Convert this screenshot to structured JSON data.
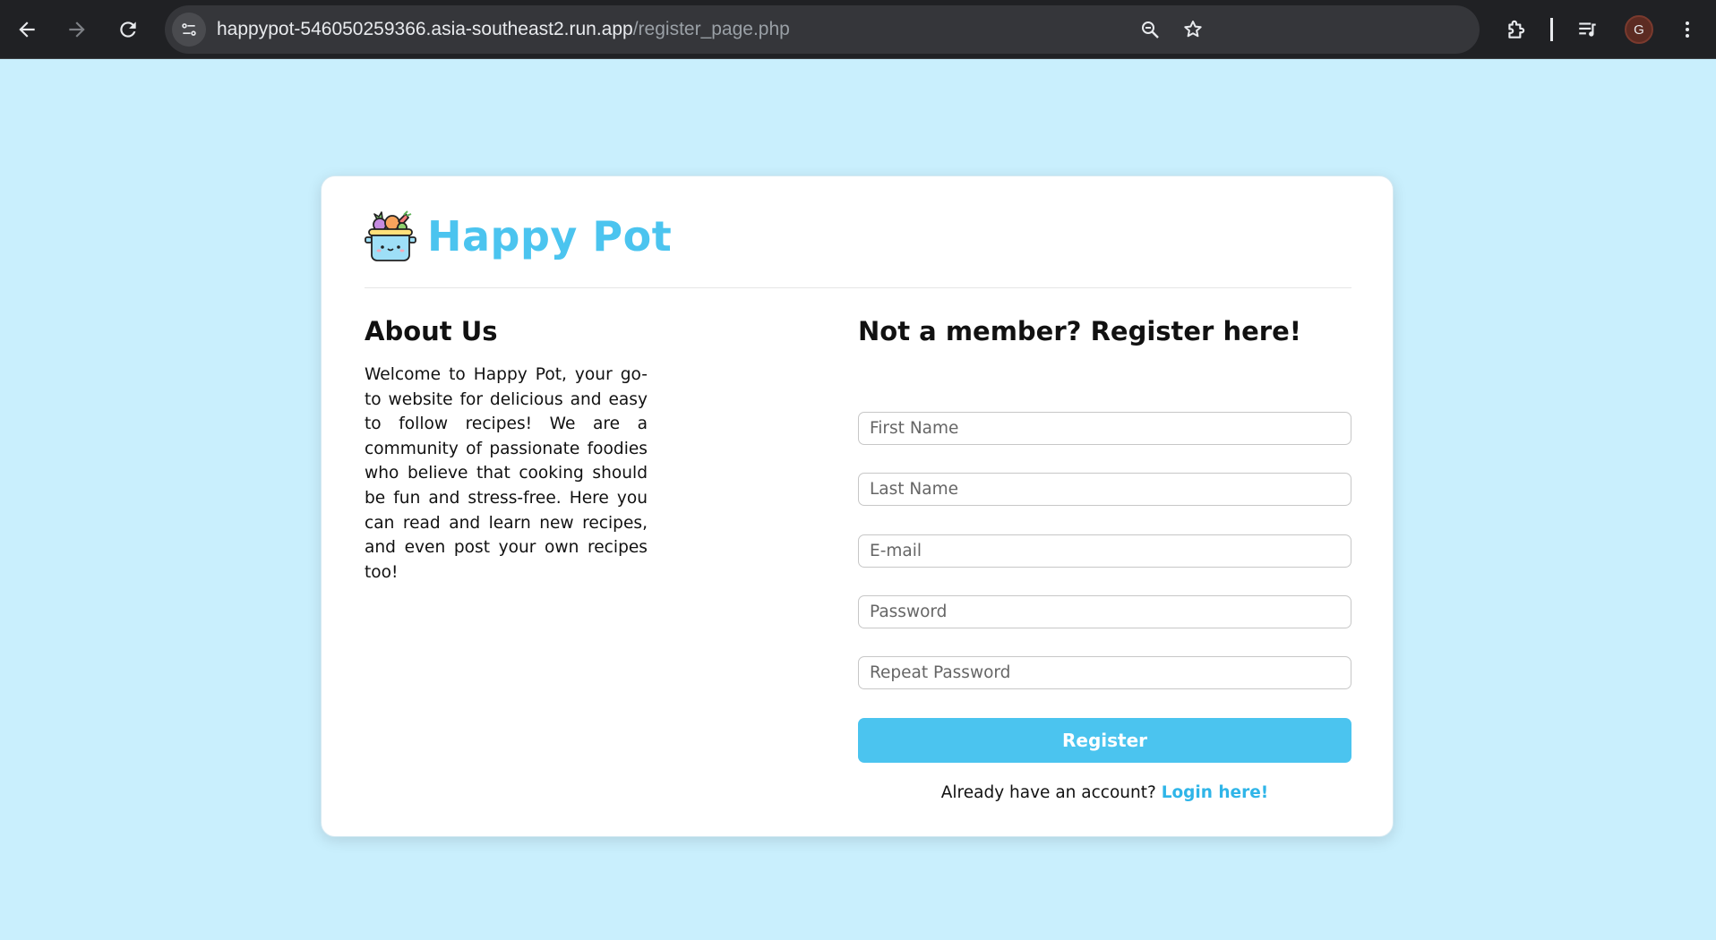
{
  "browser": {
    "url_host": "happypot-546050259366.asia-southeast2.run.app",
    "url_path": "/register_page.php",
    "profile_initial": "G",
    "icons": [
      "back-arrow-icon",
      "forward-arrow-icon",
      "reload-icon",
      "site-info-icon",
      "zoom-icon",
      "bookmark-star-icon",
      "extensions-icon",
      "media-control-icon",
      "more-vert-icon"
    ]
  },
  "brand": {
    "name": "Happy Pot",
    "logo_icon": "pot-of-vegetables-icon",
    "color": "#4bc4ef"
  },
  "about": {
    "title": "About Us",
    "text": "Welcome to Happy Pot, your go-to website for delicious and easy to follow recipes! We are a community of passionate foodies who believe that cooking should be fun and stress-free. Here you can read and learn new recipes, and even post your own recipes too!"
  },
  "register": {
    "title": "Not a member? Register here!",
    "fields": {
      "first_name": "First Name",
      "last_name": "Last Name",
      "email": "E-mail",
      "password": "Password",
      "repeat_password": "Repeat Password"
    },
    "button_label": "Register",
    "login_prompt": "Already have an account?",
    "login_link": "Login here!"
  },
  "colors": {
    "page_background": "#c9effd",
    "accent": "#4bc4ef"
  }
}
